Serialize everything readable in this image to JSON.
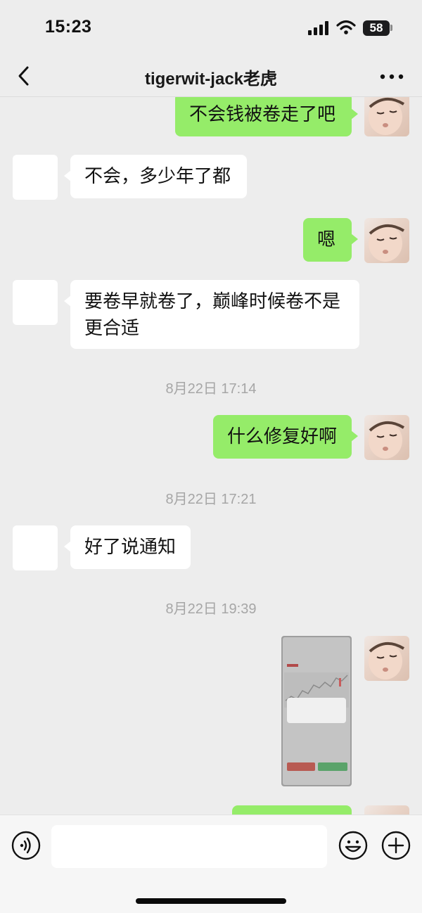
{
  "status": {
    "time": "15:23",
    "battery": "58"
  },
  "nav": {
    "title": "tigerwit-jack老虎"
  },
  "messages": {
    "m1": "不会钱被卷走了吧",
    "m2": "不会，多少年了都",
    "m3": "嗯",
    "m4_line1": "要卷早就卷了，巅峰时候卷不是",
    "m4_line2": "更合适",
    "t1": "8月22日 17:14",
    "m5": "什么修复好啊",
    "t2": "8月22日 17:21",
    "m6": "好了说通知",
    "t3": "8月22日 19:39"
  },
  "colors": {
    "outgoing": "#95ec69",
    "incoming": "#ffffff",
    "background": "#ededed"
  }
}
